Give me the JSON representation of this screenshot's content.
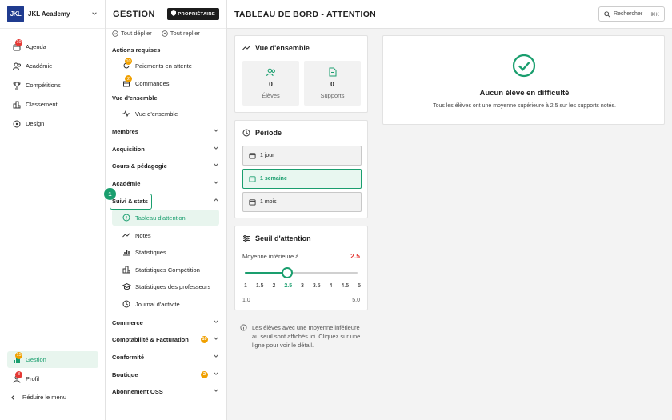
{
  "brand": {
    "logo": "JKL",
    "name": "JKL Academy"
  },
  "sidebar": {
    "items": [
      {
        "label": "Agenda",
        "badge": "10",
        "icon": "calendar-icon"
      },
      {
        "label": "Académie",
        "icon": "users-icon"
      },
      {
        "label": "Compétitions",
        "icon": "trophy-icon"
      },
      {
        "label": "Classement",
        "icon": "podium-icon"
      },
      {
        "label": "Design",
        "icon": "palette-icon"
      }
    ],
    "bottom": [
      {
        "label": "Gestion",
        "badge": "15",
        "icon": "gestion-icon"
      },
      {
        "label": "Profil",
        "badge": "8",
        "icon": "user-icon"
      }
    ],
    "collapse_label": "Réduire le menu"
  },
  "gestion": {
    "title": "GESTION",
    "owner_label": "PROPRIÉTAIRE",
    "expand_all": "Tout déplier",
    "collapse_all": "Tout replier",
    "sections": {
      "actions": "Actions requises",
      "overview": "Vue d'ensemble"
    },
    "action_items": [
      {
        "label": "Paiements en attente",
        "badge": "10"
      },
      {
        "label": "Commandes",
        "badge": "2"
      }
    ],
    "overview_item": "Vue d'ensemble",
    "categories": [
      "Membres",
      "Acquisition",
      "Cours & pédagogie",
      "Académie",
      "Suivi & stats"
    ],
    "suivi_items": [
      {
        "label": "Tableau d'attention",
        "icon": "alert-circle-icon"
      },
      {
        "label": "Notes",
        "icon": "trend-icon"
      },
      {
        "label": "Statistiques",
        "icon": "bar-chart-icon"
      },
      {
        "label": "Statistiques Compétition",
        "icon": "podium-icon"
      },
      {
        "label": "Statistiques des professeurs",
        "icon": "graduation-cap-icon"
      },
      {
        "label": "Journal d'activité",
        "icon": "clock-icon"
      }
    ],
    "bottom_categories": [
      {
        "label": "Commerce"
      },
      {
        "label": "Comptabilité & Facturation",
        "badge": "10"
      },
      {
        "label": "Conformité"
      },
      {
        "label": "Boutique",
        "badge": "2"
      },
      {
        "label": "Abonnement OSS"
      }
    ],
    "step_badge": "1"
  },
  "main": {
    "title": "TABLEAU DE BORD - ATTENTION",
    "search_label": "Rechercher",
    "search_shortcut": "⌘K"
  },
  "overview_card": {
    "title": "Vue d'ensemble",
    "stats": [
      {
        "value": "0",
        "label": "Élèves"
      },
      {
        "value": "0",
        "label": "Supports"
      }
    ]
  },
  "period_card": {
    "title": "Période",
    "options": [
      "1 jour",
      "1 semaine",
      "1 mois"
    ],
    "selected": "1 semaine"
  },
  "threshold_card": {
    "title": "Seuil d'attention",
    "label": "Moyenne inférieure à",
    "value": "2.5",
    "ticks": [
      "1",
      "1.5",
      "2",
      "2.5",
      "3",
      "3.5",
      "4",
      "4.5",
      "5"
    ],
    "selected_tick": "2.5",
    "min": "1.0",
    "max": "5.0",
    "fraction": 0.375
  },
  "info_text": "Les élèves avec une moyenne inférieure au seuil sont affichés ici. Cliquez sur une ligne pour voir le détail.",
  "empty_state": {
    "title": "Aucun élève en difficulté",
    "subtitle": "Tous les élèves ont une moyenne supérieure à 2.5 sur les supports notés."
  },
  "colors": {
    "accent": "#1a9e6e",
    "danger": "#e53935",
    "warning": "#f0a000",
    "brand": "#1f3b8f"
  }
}
